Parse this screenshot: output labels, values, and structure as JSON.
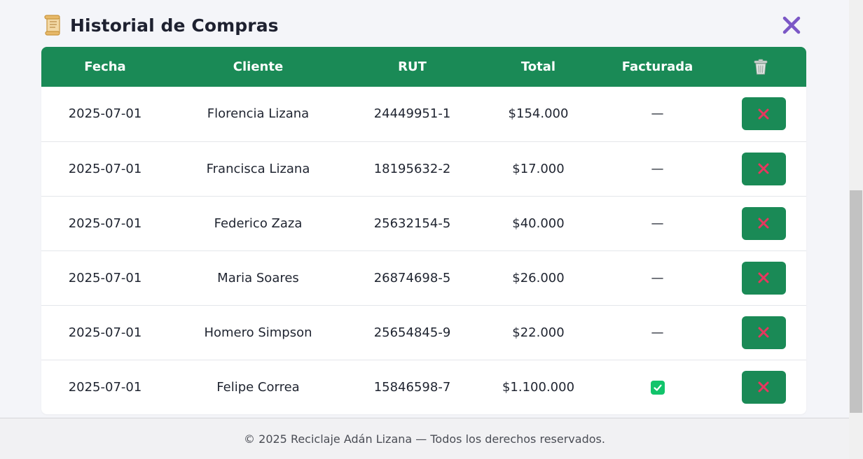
{
  "header": {
    "title": "Historial de Compras",
    "title_icon": "scroll-icon",
    "close_icon": "close-icon"
  },
  "table": {
    "columns": [
      "Fecha",
      "Cliente",
      "RUT",
      "Total",
      "Facturada"
    ],
    "delete_column_icon": "trash-icon",
    "rows": [
      {
        "fecha": "2025-07-01",
        "cliente": "Florencia Lizana",
        "rut": "24449951-1",
        "total": "$154.000",
        "facturada": "—"
      },
      {
        "fecha": "2025-07-01",
        "cliente": "Francisca Lizana",
        "rut": "18195632-2",
        "total": "$17.000",
        "facturada": "—"
      },
      {
        "fecha": "2025-07-01",
        "cliente": "Federico Zaza",
        "rut": "25632154-5",
        "total": "$40.000",
        "facturada": "—"
      },
      {
        "fecha": "2025-07-01",
        "cliente": "Maria Soares",
        "rut": "26874698-5",
        "total": "$26.000",
        "facturada": "—"
      },
      {
        "fecha": "2025-07-01",
        "cliente": "Homero Simpson",
        "rut": "25654845-9",
        "total": "$22.000",
        "facturada": "—"
      },
      {
        "fecha": "2025-07-01",
        "cliente": "Felipe Correa",
        "rut": "15846598-7",
        "total": "$1.100.000",
        "facturada": "check"
      }
    ]
  },
  "footer": {
    "text": "© 2025 Reciclaje Adán Lizana — Todos los derechos reservados."
  },
  "colors": {
    "primary": "#1a8a56",
    "close_accent": "#7b57c6",
    "delete_x": "#e8365f",
    "check": "#12c46b"
  }
}
